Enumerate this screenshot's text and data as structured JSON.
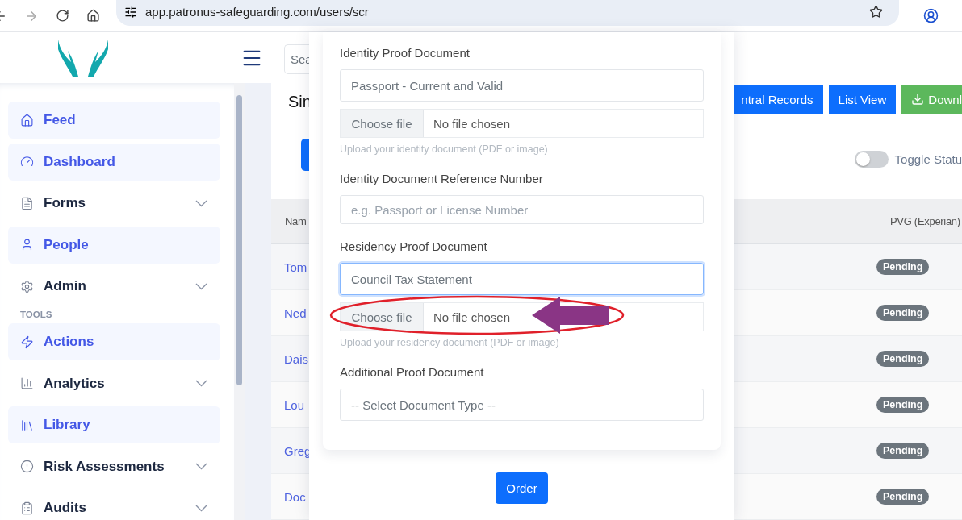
{
  "browser": {
    "url": "app.patronus-safeguarding.com/users/scr"
  },
  "sidebar": {
    "items": [
      {
        "kind": "link",
        "label": "Feed"
      },
      {
        "kind": "link",
        "label": "Dashboard"
      },
      {
        "kind": "group",
        "label": "Forms"
      },
      {
        "kind": "link",
        "label": "People"
      },
      {
        "kind": "group",
        "label": "Admin"
      },
      {
        "kind": "section",
        "label": "TOOLS"
      },
      {
        "kind": "link",
        "label": "Actions"
      },
      {
        "kind": "group",
        "label": "Analytics"
      },
      {
        "kind": "link",
        "label": "Library"
      },
      {
        "kind": "group",
        "label": "Risk Assessments"
      },
      {
        "kind": "group",
        "label": "Audits"
      }
    ]
  },
  "header": {
    "search": {
      "placeholder": "Sea"
    }
  },
  "page": {
    "title": "Sin",
    "buttons": [
      {
        "kind": "primary",
        "label": "ntral Records"
      },
      {
        "kind": "primary",
        "label": "List View"
      },
      {
        "kind": "success",
        "label": "Downl"
      }
    ],
    "toggle": {
      "label": "Toggle Statu",
      "on": false
    }
  },
  "table": {
    "columns": [
      "Nam",
      "PVG (Experian)"
    ],
    "rows": [
      {
        "name": "Tom",
        "status": "Pending"
      },
      {
        "name": "Ned",
        "status": "Pending"
      },
      {
        "name": "Dais",
        "status": "Pending"
      },
      {
        "name": "Lou",
        "status": "Pending"
      },
      {
        "name": "Greg",
        "status": "Pending"
      },
      {
        "name": "Doc",
        "status": "Pending"
      }
    ]
  },
  "modal": {
    "fields": [
      {
        "kind": "select",
        "label": "Identity Proof Document",
        "value": "Passport - Current and Valid",
        "focused": false
      },
      {
        "kind": "file",
        "button": "Choose file",
        "status": "No file chosen",
        "help": "Upload your identity document (PDF or image)"
      },
      {
        "kind": "text",
        "label": "Identity Document Reference Number",
        "placeholder": "e.g. Passport or License Number",
        "focused": false
      },
      {
        "kind": "select",
        "label": "Residency Proof Document",
        "value": "Council Tax Statement",
        "focused": true
      },
      {
        "kind": "file",
        "button": "Choose file",
        "status": "No file chosen",
        "help": "Upload your residency document (PDF or image)"
      },
      {
        "kind": "select",
        "label": "Additional Proof Document",
        "value": "-- Select Document Type --",
        "focused": false
      }
    ],
    "submit": "Order"
  }
}
